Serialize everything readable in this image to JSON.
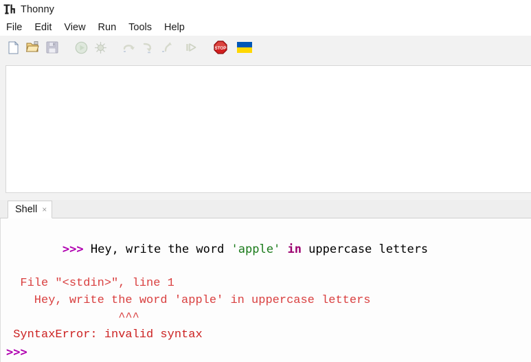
{
  "window": {
    "title": "Thonny",
    "app_icon": "thonny-logo-icon"
  },
  "menubar": {
    "items": [
      {
        "label": "File",
        "name": "menu-file"
      },
      {
        "label": "Edit",
        "name": "menu-edit"
      },
      {
        "label": "View",
        "name": "menu-view"
      },
      {
        "label": "Run",
        "name": "menu-run"
      },
      {
        "label": "Tools",
        "name": "menu-tools"
      },
      {
        "label": "Help",
        "name": "menu-help"
      }
    ]
  },
  "toolbar": {
    "buttons": [
      {
        "name": "new-file-icon",
        "label": "New",
        "enabled": true
      },
      {
        "name": "open-file-icon",
        "label": "Open",
        "enabled": true
      },
      {
        "name": "save-file-icon",
        "label": "Save",
        "enabled": false
      },
      {
        "name": "run-icon",
        "label": "Run",
        "enabled": false
      },
      {
        "name": "debug-icon",
        "label": "Debug",
        "enabled": false
      },
      {
        "name": "step-over-icon",
        "label": "Step over",
        "enabled": false
      },
      {
        "name": "step-into-icon",
        "label": "Step into",
        "enabled": false
      },
      {
        "name": "step-out-icon",
        "label": "Step out",
        "enabled": false
      },
      {
        "name": "resume-icon",
        "label": "Resume",
        "enabled": false
      },
      {
        "name": "stop-icon",
        "label": "Stop",
        "enabled": true
      },
      {
        "name": "ukraine-flag-icon",
        "label": "Support Ukraine",
        "enabled": true
      }
    ]
  },
  "editor": {
    "content": ""
  },
  "shell_panel": {
    "tab": {
      "label": "Shell",
      "close_glyph": "×"
    },
    "lines": [
      {
        "name": "shell-input-line",
        "segments": [
          {
            "text": ">>>",
            "style": "prompt"
          },
          {
            "text": " Hey, write the word ",
            "style": "plain"
          },
          {
            "text": "'apple'",
            "style": "string"
          },
          {
            "text": " ",
            "style": "plain"
          },
          {
            "text": "in",
            "style": "keyword"
          },
          {
            "text": " uppercase letters",
            "style": "plain"
          }
        ]
      },
      {
        "name": "traceback-file-line",
        "segments": [
          {
            "text": "  File \"<stdin>\", line 1",
            "style": "error"
          }
        ]
      },
      {
        "name": "traceback-source-line",
        "segments": [
          {
            "text": "    Hey, write the word 'apple' in uppercase letters",
            "style": "error"
          }
        ]
      },
      {
        "name": "traceback-caret-line",
        "segments": [
          {
            "text": "                ^^^",
            "style": "error"
          }
        ]
      },
      {
        "name": "traceback-exception-line",
        "segments": [
          {
            "text": " SyntaxError: invalid syntax",
            "style": "error-strong"
          }
        ]
      },
      {
        "name": "shell-blank-line",
        "segments": [
          {
            "text": "",
            "style": "plain"
          }
        ]
      },
      {
        "name": "shell-prompt-line",
        "segments": [
          {
            "text": ">>>",
            "style": "prompt"
          }
        ]
      }
    ]
  },
  "colors": {
    "prompt_purple": "#b000b0",
    "keyword_purple": "#9c0070",
    "string_green": "#1a7a1a",
    "error_red": "#d93f3f",
    "toolbar_bg": "#f2f2f2",
    "tabstrip_bg": "#eeeeee",
    "shell_bg": "#fdfdfd",
    "editor_bg": "#ffffff"
  }
}
